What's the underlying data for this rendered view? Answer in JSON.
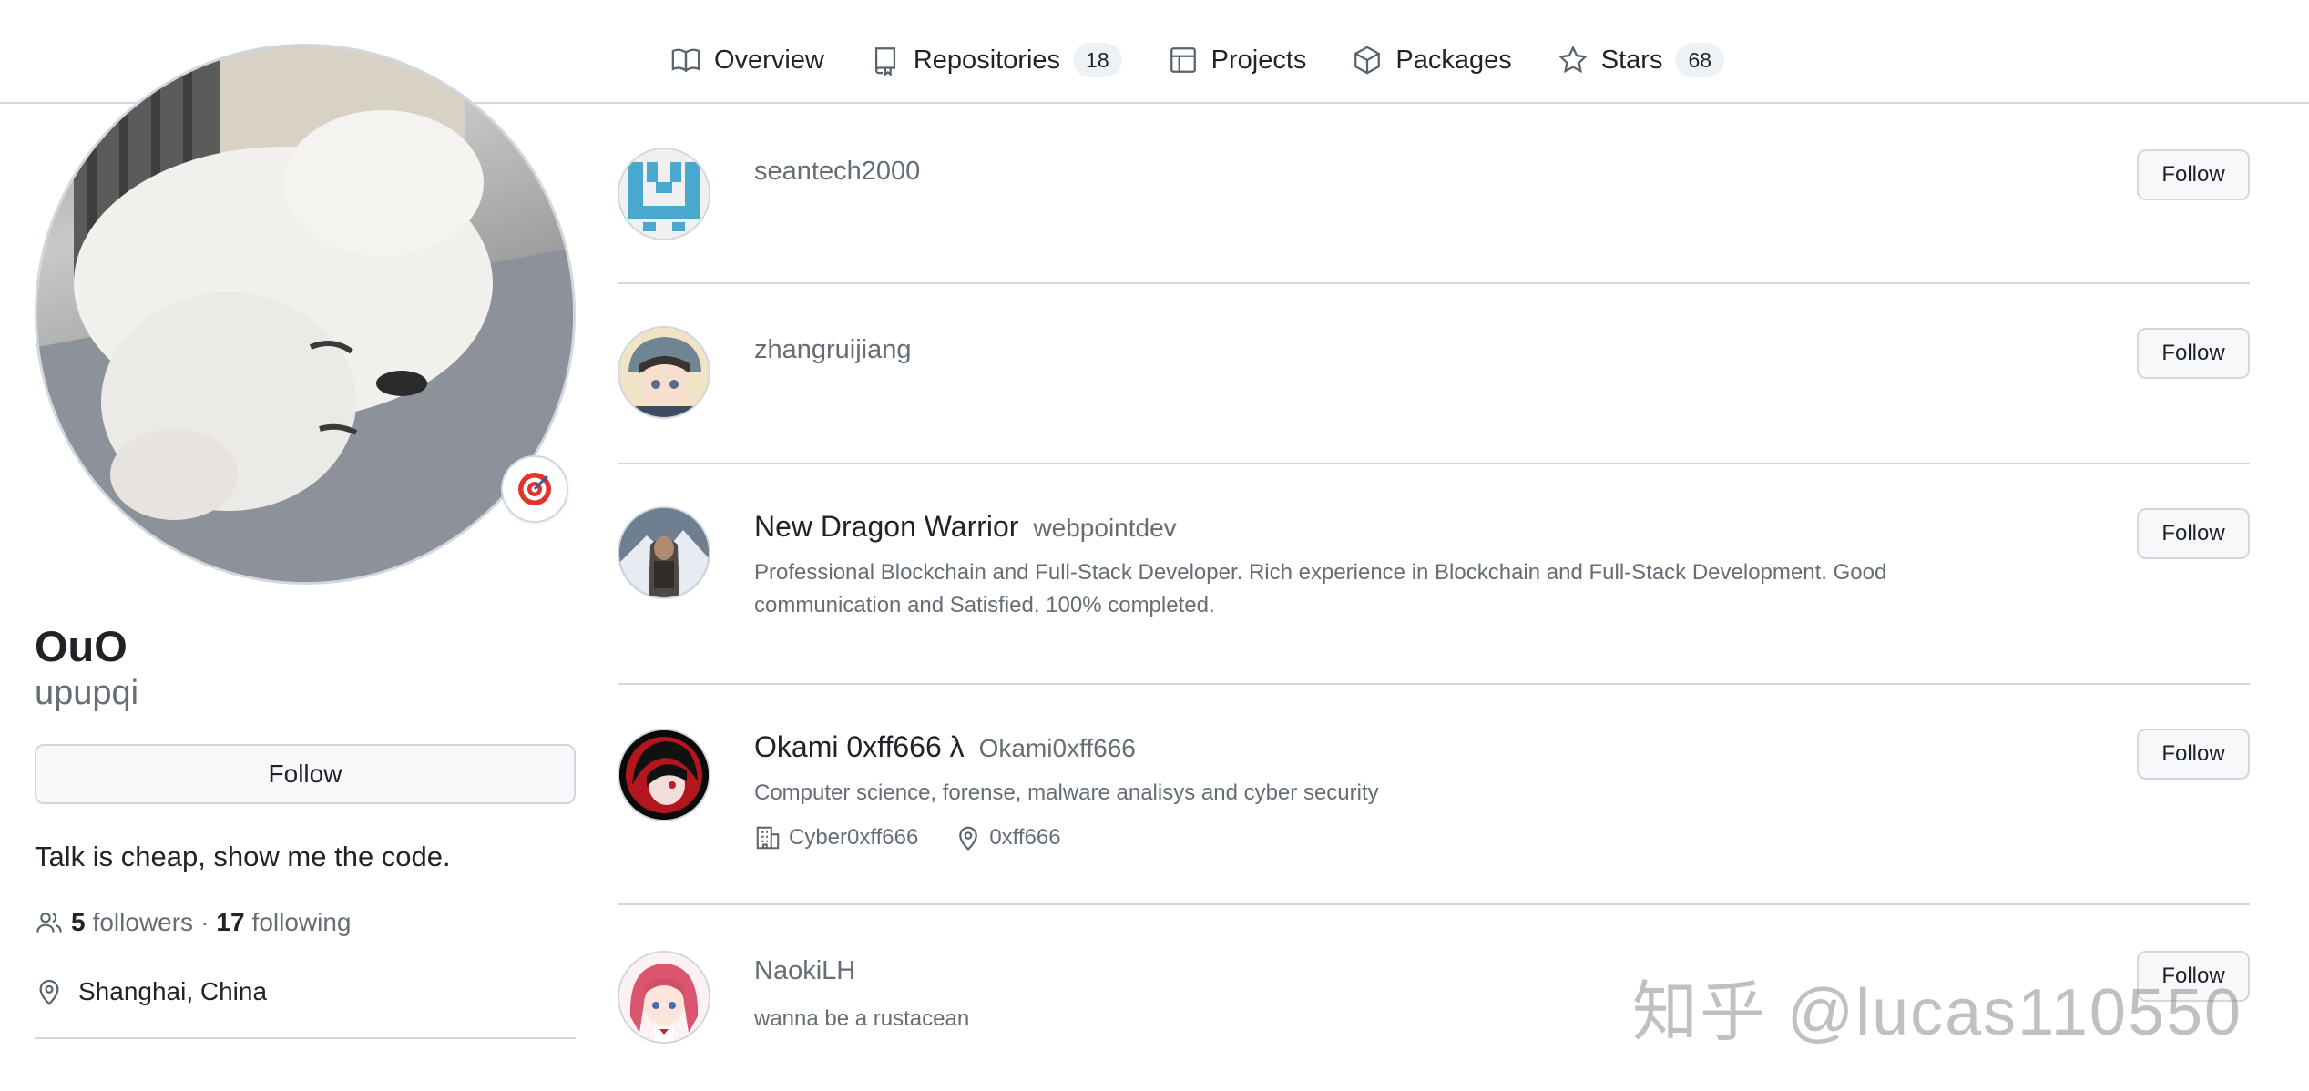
{
  "nav": {
    "tabs": [
      {
        "label": "Overview",
        "icon": "book-icon"
      },
      {
        "label": "Repositories",
        "icon": "repo-icon",
        "count": "18"
      },
      {
        "label": "Projects",
        "icon": "table-icon"
      },
      {
        "label": "Packages",
        "icon": "package-icon"
      },
      {
        "label": "Stars",
        "icon": "star-icon",
        "count": "68"
      }
    ]
  },
  "profile": {
    "display_name": "OuO",
    "login": "upupqi",
    "follow_label": "Follow",
    "bio": "Talk is cheap, show me the code.",
    "followers_count": "5",
    "followers_label": "followers",
    "separator": "·",
    "following_count": "17",
    "following_label": "following",
    "location": "Shanghai, China",
    "status_icon": "target-icon"
  },
  "following": [
    {
      "name": "",
      "login": "seantech2000",
      "bio": "",
      "follow_label": "Follow"
    },
    {
      "name": "",
      "login": "zhangruijiang",
      "bio": "",
      "follow_label": "Follow"
    },
    {
      "name": "New Dragon Warrior",
      "login": "webpointdev",
      "bio": "Professional Blockchain and Full-Stack Developer. Rich experience in Blockchain and Full-Stack Development. Good communication and Satisfied. 100% completed.",
      "follow_label": "Follow"
    },
    {
      "name": "Okami 0xff666 λ",
      "login": "Okami0xff666",
      "bio": "Computer science, forense, malware analisys and cyber security",
      "company": "Cyber0xff666",
      "location": "0xff666",
      "follow_label": "Follow"
    },
    {
      "name": "",
      "login": "NaokiLH",
      "bio": "wanna be a rustacean",
      "follow_label": "Follow"
    }
  ],
  "watermark": "知乎 @lucas110550",
  "colors": {
    "border": "#d0d7de",
    "muted_text": "#656d76",
    "text": "#1f2328",
    "button_bg": "#f6f8fa"
  }
}
